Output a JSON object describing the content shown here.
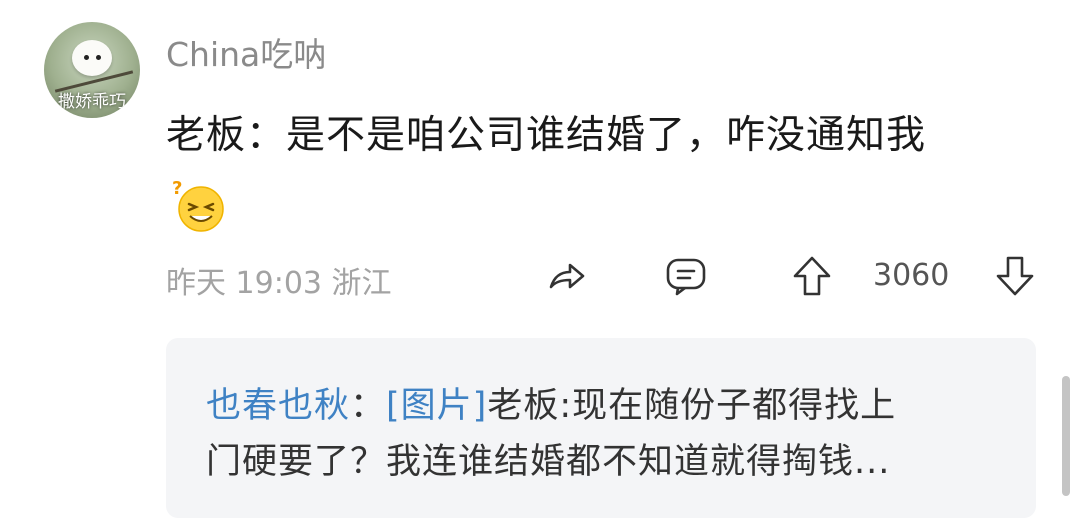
{
  "comment": {
    "avatar_text": "撒娇乖巧",
    "username": "China吃呐",
    "text": "老板：是不是咱公司谁结婚了，咋没通知我",
    "emoji": "confused-laughing-emoji",
    "timestamp": "昨天 19:03",
    "location": "浙江",
    "vote_count": "3060"
  },
  "reply": {
    "user": "也春也秋",
    "separator": "：",
    "tag": "[图片]",
    "line1_rest": "老板:现在随份子都得找上",
    "line2": "门硬要了？我连谁结婚都不知道就得掏钱..."
  },
  "icons": [
    "share-icon",
    "comment-icon",
    "upvote-icon",
    "downvote-icon"
  ],
  "colors": {
    "username": "#8a8a8a",
    "meta": "#a3a3a3",
    "reply_link": "#3f82c4",
    "reply_bg": "#f4f5f7"
  }
}
